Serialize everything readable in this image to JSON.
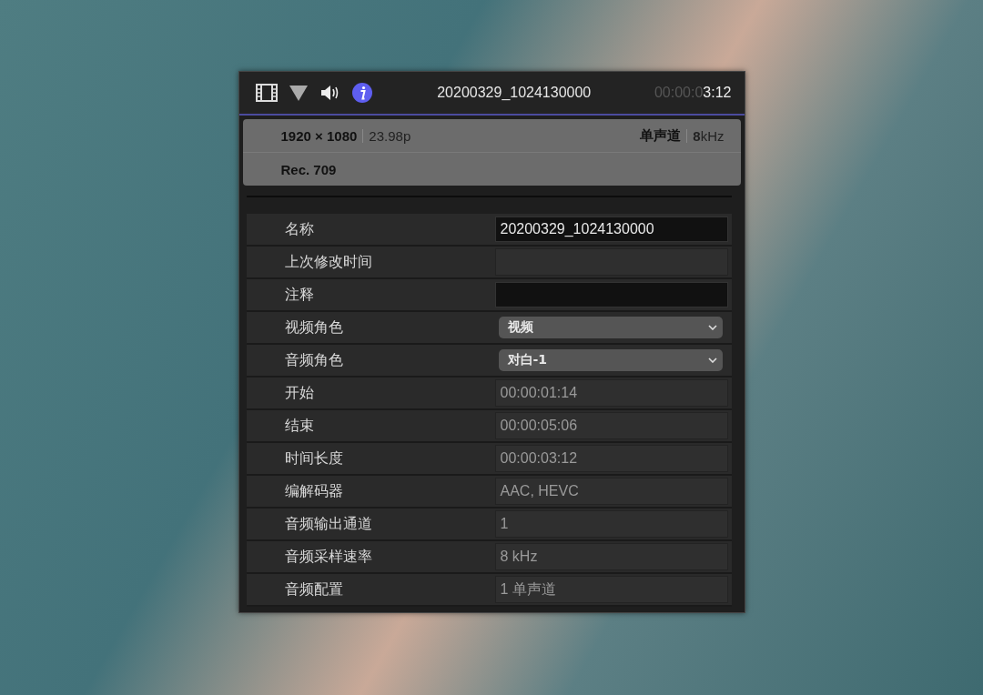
{
  "toolbar": {
    "tabs": [
      {
        "kind": "film",
        "selected": false
      },
      {
        "kind": "color",
        "selected": false
      },
      {
        "kind": "audio",
        "selected": false
      },
      {
        "kind": "info",
        "selected": true
      }
    ],
    "clip_name": "20200329_1024130000",
    "timecode_dim": "00:00:0",
    "timecode_bright": "3:12"
  },
  "summary": {
    "resolution": "1920 × 1080",
    "frame_rate": "23.98p",
    "channels": "单声道",
    "sample_rate": "**8**kHz",
    "color_space": "Rec. 709"
  },
  "properties": [
    {
      "label": "名称",
      "kind": "input",
      "value": "20200329_1024130000"
    },
    {
      "label": "上次修改时间",
      "kind": "readonly"
    },
    {
      "label": "注释",
      "kind": "input"
    },
    {
      "label": "视频角色",
      "kind": "select",
      "value": "视频"
    },
    {
      "label": "音频角色",
      "kind": "select",
      "value": "对白-1"
    },
    {
      "label": "开始",
      "kind": "readonly",
      "value": "00:00:01:14"
    },
    {
      "label": "结束",
      "kind": "readonly",
      "value": "00:00:05:06"
    },
    {
      "label": "时间长度",
      "kind": "readonly",
      "value": "00:00:03:12"
    },
    {
      "label": "编解码器",
      "kind": "readonly",
      "value": "AAC, HEVC"
    },
    {
      "label": "音频输出通道",
      "kind": "readonly",
      "value": "1"
    },
    {
      "label": "音频采样速率",
      "kind": "readonly",
      "value": "8 kHz"
    },
    {
      "label": "音频配置",
      "kind": "readonly",
      "value": "1 单声道"
    }
  ]
}
